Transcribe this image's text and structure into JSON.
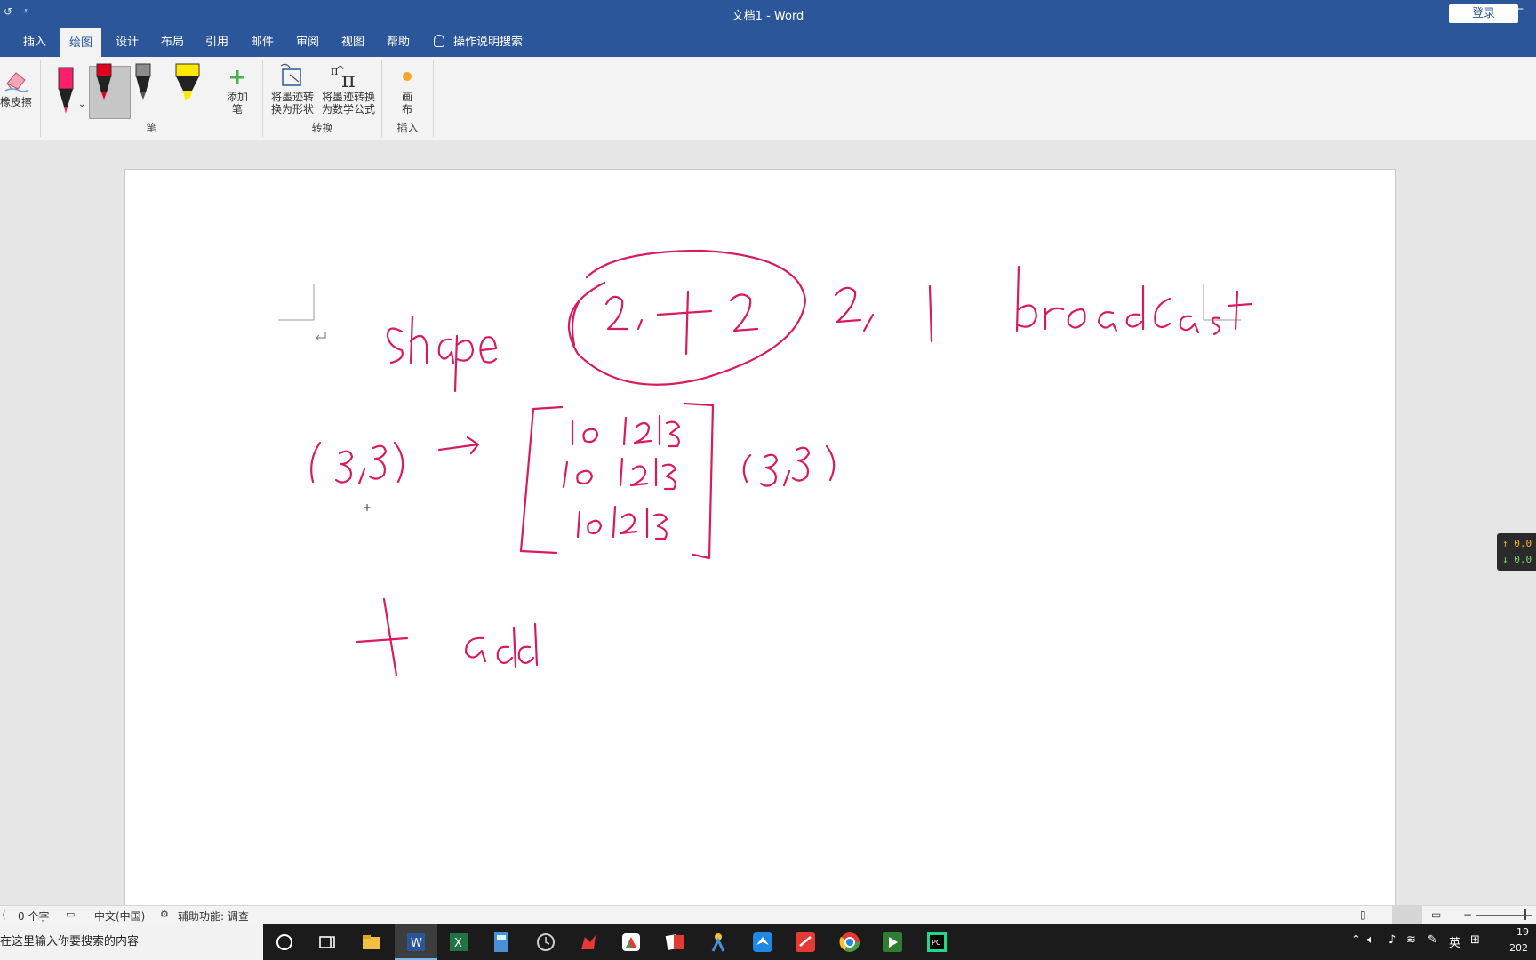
{
  "window": {
    "title": "文档1  -  Word",
    "login_label": "登录"
  },
  "tabs": [
    {
      "label": "插入"
    },
    {
      "label": "绘图"
    },
    {
      "label": "设计"
    },
    {
      "label": "布局"
    },
    {
      "label": "引用"
    },
    {
      "label": "邮件"
    },
    {
      "label": "审阅"
    },
    {
      "label": "视图"
    },
    {
      "label": "帮助"
    }
  ],
  "tell_me": "操作说明搜索",
  "ribbon": {
    "eraser_label": "橡皮擦",
    "add_pen_label_1": "添加",
    "add_pen_label_2": "笔",
    "pens_group_label": "笔",
    "convert_shape_1": "将墨迹转",
    "convert_shape_2": "换为形状",
    "convert_math_1": "将墨迹转换",
    "convert_math_2": "为数学公式",
    "convert_group_label": "转换",
    "canvas_label_1": "画",
    "canvas_label_2": "布",
    "insert_group_label": "插入"
  },
  "colors": {
    "title_bar": "#2b579a",
    "ink": "#d81b60",
    "ribbon_bg": "#f3f3f3"
  },
  "float_widget": {
    "up": "↑ 0.0",
    "down": "↓ 0.0"
  },
  "status": {
    "word_count": "0 个字",
    "language": "中文(中国)",
    "accessibility": "辅助功能: 调查"
  },
  "taskbar": {
    "search_placeholder": "在这里输入你要搜索的内容",
    "ime": "英",
    "clock_1": "19",
    "clock_2": "202"
  }
}
